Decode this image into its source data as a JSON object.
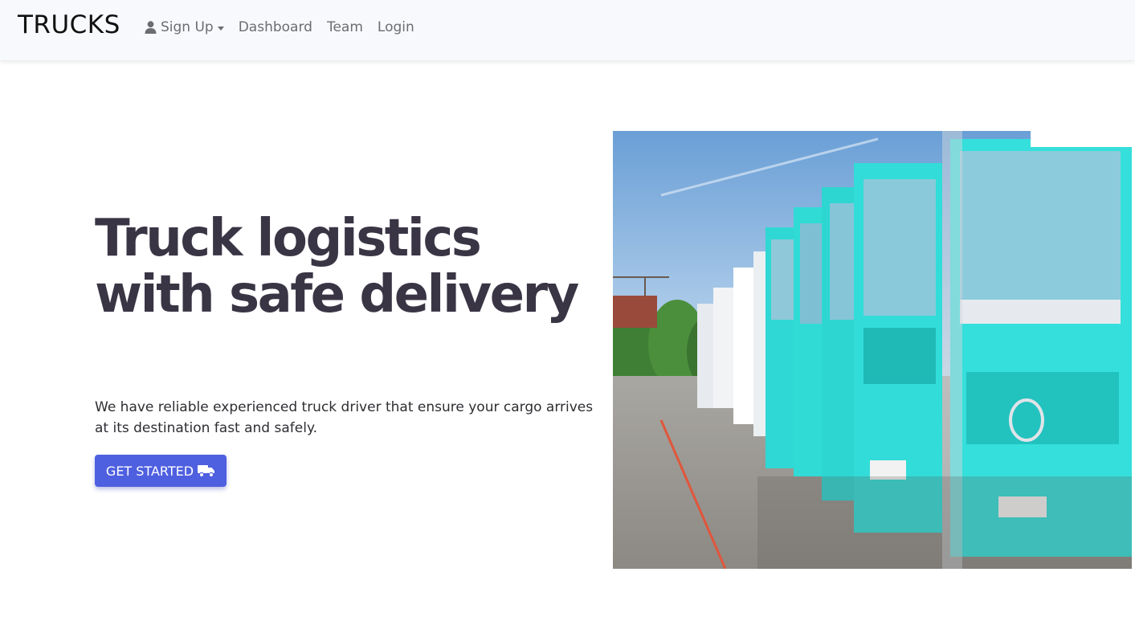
{
  "navbar": {
    "brand": "TRUCKS",
    "links": [
      {
        "label": "Sign Up",
        "icon": "user-icon",
        "dropdown": true
      },
      {
        "label": "Dashboard"
      },
      {
        "label": "Team"
      },
      {
        "label": "Login"
      }
    ]
  },
  "hero": {
    "title": "Truck logistics with safe delivery",
    "description": "We have reliable experienced truck driver that ensure your cargo arrives at its destination fast and safely.",
    "cta_label": "GET STARTED",
    "cta_icon": "truck-icon",
    "image_subject": "row of turquoise trucks"
  },
  "colors": {
    "accent": "#4e5fe0",
    "heading": "#3a3545",
    "navbar_bg": "#f8f9fc",
    "truck_cab": "#2fd8d4"
  }
}
